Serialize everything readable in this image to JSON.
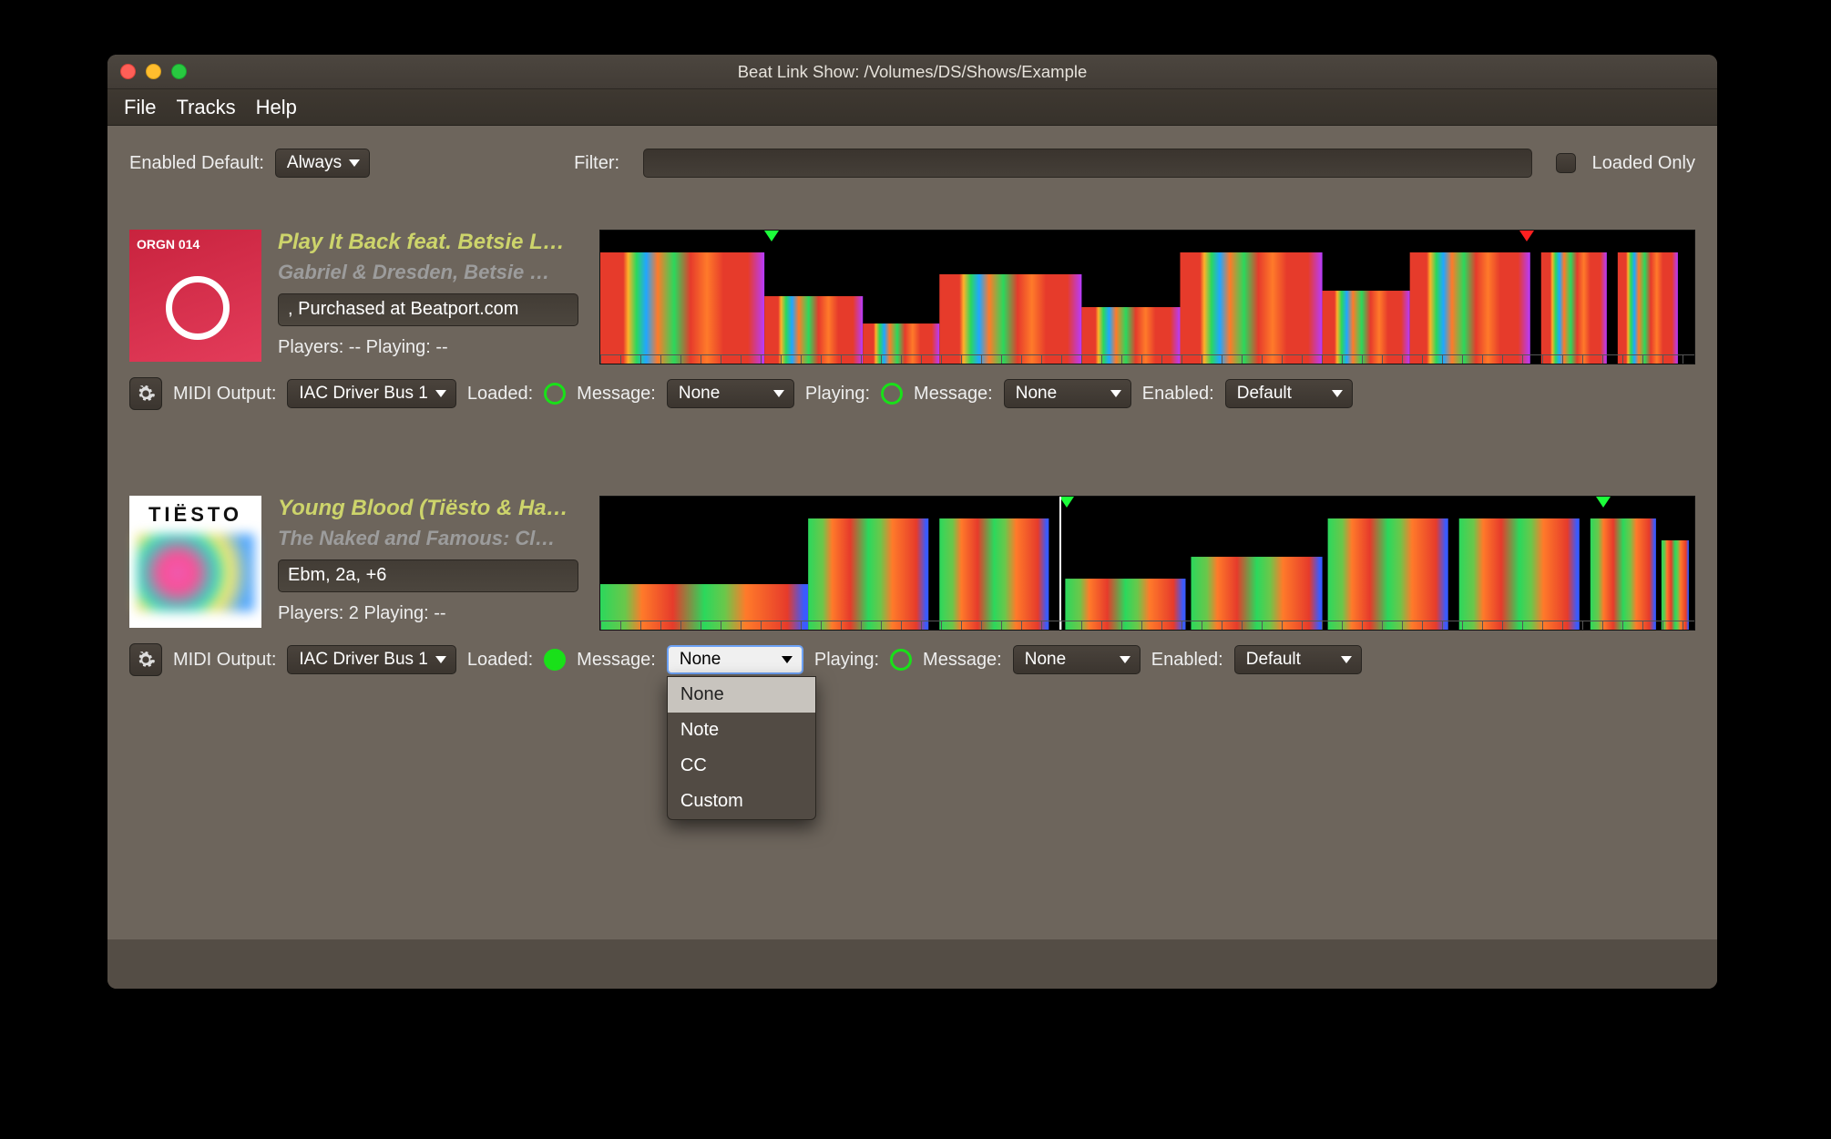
{
  "window": {
    "title": "Beat Link Show: /Volumes/DS/Shows/Example"
  },
  "menu": {
    "items": [
      "File",
      "Tracks",
      "Help"
    ]
  },
  "toolbar": {
    "enabled_default_label": "Enabled Default:",
    "enabled_default_value": "Always",
    "filter_label": "Filter:",
    "filter_value": "",
    "loaded_only_label": "Loaded Only"
  },
  "controls": {
    "midi_output_label": "MIDI Output:",
    "loaded_label": "Loaded:",
    "message_label": "Message:",
    "playing_label": "Playing:",
    "enabled_label": "Enabled:"
  },
  "message_options": [
    "None",
    "Note",
    "CC",
    "Custom"
  ],
  "tracks": [
    {
      "title": "Play It Back feat. Betsie L…",
      "artist": "Gabriel & Dresden, Betsie …",
      "artwork_tag": "ORGN 014",
      "comment": ", Purchased at Beatport.com",
      "players_line": "Players: --  Playing: --",
      "midi_output": "IAC Driver Bus 1",
      "loaded_message": "None",
      "playing_message": "None",
      "enabled": "Default"
    },
    {
      "title": "Young Blood (Tiësto & Ha…",
      "artist": "The Naked and Famous: Cl…",
      "artwork_tag": "TIËSTO",
      "comment": "Ebm, 2a, +6",
      "players_line": "Players: 2  Playing: --",
      "midi_output": "IAC Driver Bus 1",
      "loaded_message": "None",
      "playing_message": "None",
      "enabled": "Default"
    }
  ]
}
